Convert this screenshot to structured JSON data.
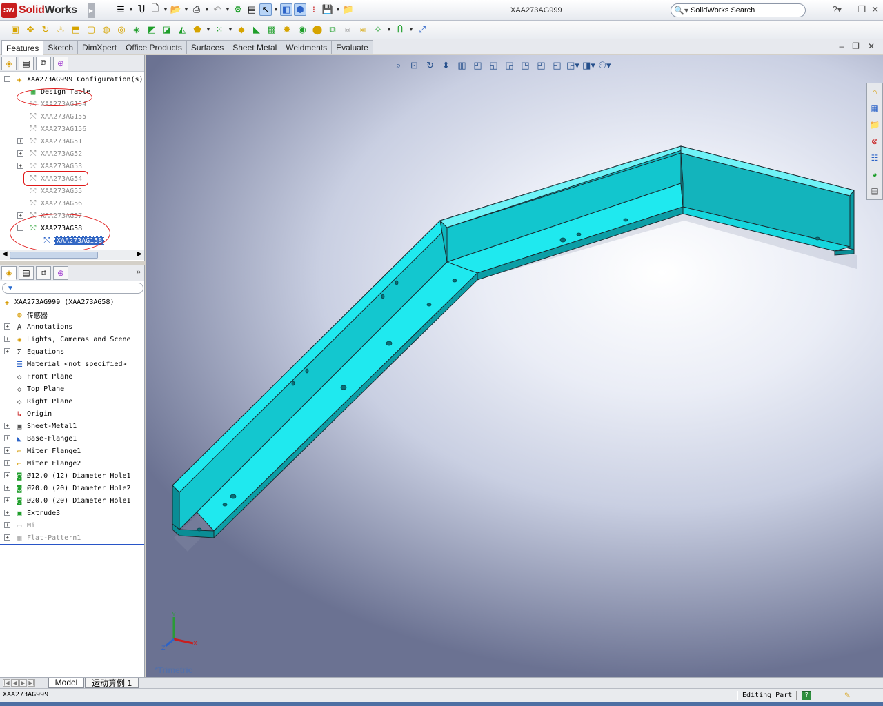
{
  "app": {
    "logo_prefix": "Solid",
    "logo_suffix": "Works",
    "logo_badge": "SW"
  },
  "document": {
    "title": "XAA273AG999"
  },
  "search": {
    "placeholder": "SolidWorks Search"
  },
  "command_tabs": [
    "Features",
    "Sketch",
    "DimXpert",
    "Office Products",
    "Surfaces",
    "Sheet Metal",
    "Weldments",
    "Evaluate"
  ],
  "active_tab": "Features",
  "config_tree": {
    "root": "XAA273AG999 Configuration(s)",
    "items": [
      {
        "label": "Design Table",
        "type": "table",
        "greyed": false,
        "expander": false
      },
      {
        "label": "XAA273AG154",
        "type": "config",
        "greyed": true,
        "expander": false
      },
      {
        "label": "XAA273AG155",
        "type": "config",
        "greyed": true,
        "expander": false
      },
      {
        "label": "XAA273AG156",
        "type": "config",
        "greyed": true,
        "expander": false
      },
      {
        "label": "XAA273AG51",
        "type": "config",
        "greyed": true,
        "expander": true
      },
      {
        "label": "XAA273AG52",
        "type": "config",
        "greyed": true,
        "expander": true
      },
      {
        "label": "XAA273AG53",
        "type": "config",
        "greyed": true,
        "expander": true
      },
      {
        "label": "XAA273AG54",
        "type": "config",
        "greyed": true,
        "expander": false
      },
      {
        "label": "XAA273AG55",
        "type": "config",
        "greyed": true,
        "expander": false
      },
      {
        "label": "XAA273AG56",
        "type": "config",
        "greyed": true,
        "expander": false
      },
      {
        "label": "XAA273AG57",
        "type": "config",
        "greyed": true,
        "expander": true
      },
      {
        "label": "XAA273AG58",
        "type": "config",
        "greyed": false,
        "expander": true,
        "expanded": true
      },
      {
        "label": "XAA273AG158",
        "type": "derived",
        "greyed": false,
        "selected": true
      }
    ]
  },
  "feature_tree": {
    "filter_placeholder": "",
    "root": "XAA273AG999  (XAA273AG58)",
    "items": [
      {
        "label": "传感器",
        "icon": "sensor-icon",
        "expander": false
      },
      {
        "label": "Annotations",
        "icon": "annotations-icon",
        "expander": true
      },
      {
        "label": "Lights, Cameras and Scene",
        "icon": "lights-icon",
        "expander": true
      },
      {
        "label": "Equations",
        "icon": "equations-icon",
        "expander": true
      },
      {
        "label": "Material <not specified>",
        "icon": "material-icon",
        "expander": false
      },
      {
        "label": "Front Plane",
        "icon": "plane-icon",
        "expander": false
      },
      {
        "label": "Top Plane",
        "icon": "plane-icon",
        "expander": false
      },
      {
        "label": "Right Plane",
        "icon": "plane-icon",
        "expander": false
      },
      {
        "label": "Origin",
        "icon": "origin-icon",
        "expander": false
      },
      {
        "label": "Sheet-Metal1",
        "icon": "sheet-metal-icon",
        "expander": true
      },
      {
        "label": "Base-Flange1",
        "icon": "base-flange-icon",
        "expander": true
      },
      {
        "label": "Miter Flange1",
        "icon": "miter-flange-icon",
        "expander": true
      },
      {
        "label": "Miter Flange2",
        "icon": "miter-flange-icon",
        "expander": true
      },
      {
        "label": "Ø12.0 (12) Diameter Hole1",
        "icon": "hole-icon",
        "expander": true
      },
      {
        "label": "Ø20.0 (20) Diameter Hole2",
        "icon": "hole-icon",
        "expander": true
      },
      {
        "label": "Ø20.0 (20) Diameter Hole1",
        "icon": "hole-icon",
        "expander": true
      },
      {
        "label": "Extrude3",
        "icon": "extrude-icon",
        "expander": true
      },
      {
        "label": "Mi",
        "icon": "suppressed-icon",
        "expander": true,
        "greyed": true
      },
      {
        "label": "Flat-Pattern1",
        "icon": "flat-pattern-icon",
        "expander": true,
        "greyed": true
      }
    ]
  },
  "viewport": {
    "view_name": "*Trimetric",
    "part_color": "#18e3ea"
  },
  "bottom_tabs": [
    "Model",
    "运动算例 1"
  ],
  "status": {
    "left": "XAA273AG999",
    "mode": "Editing Part",
    "help": "?"
  },
  "triad": {
    "x": "X",
    "y": "Y",
    "z": "Z"
  }
}
